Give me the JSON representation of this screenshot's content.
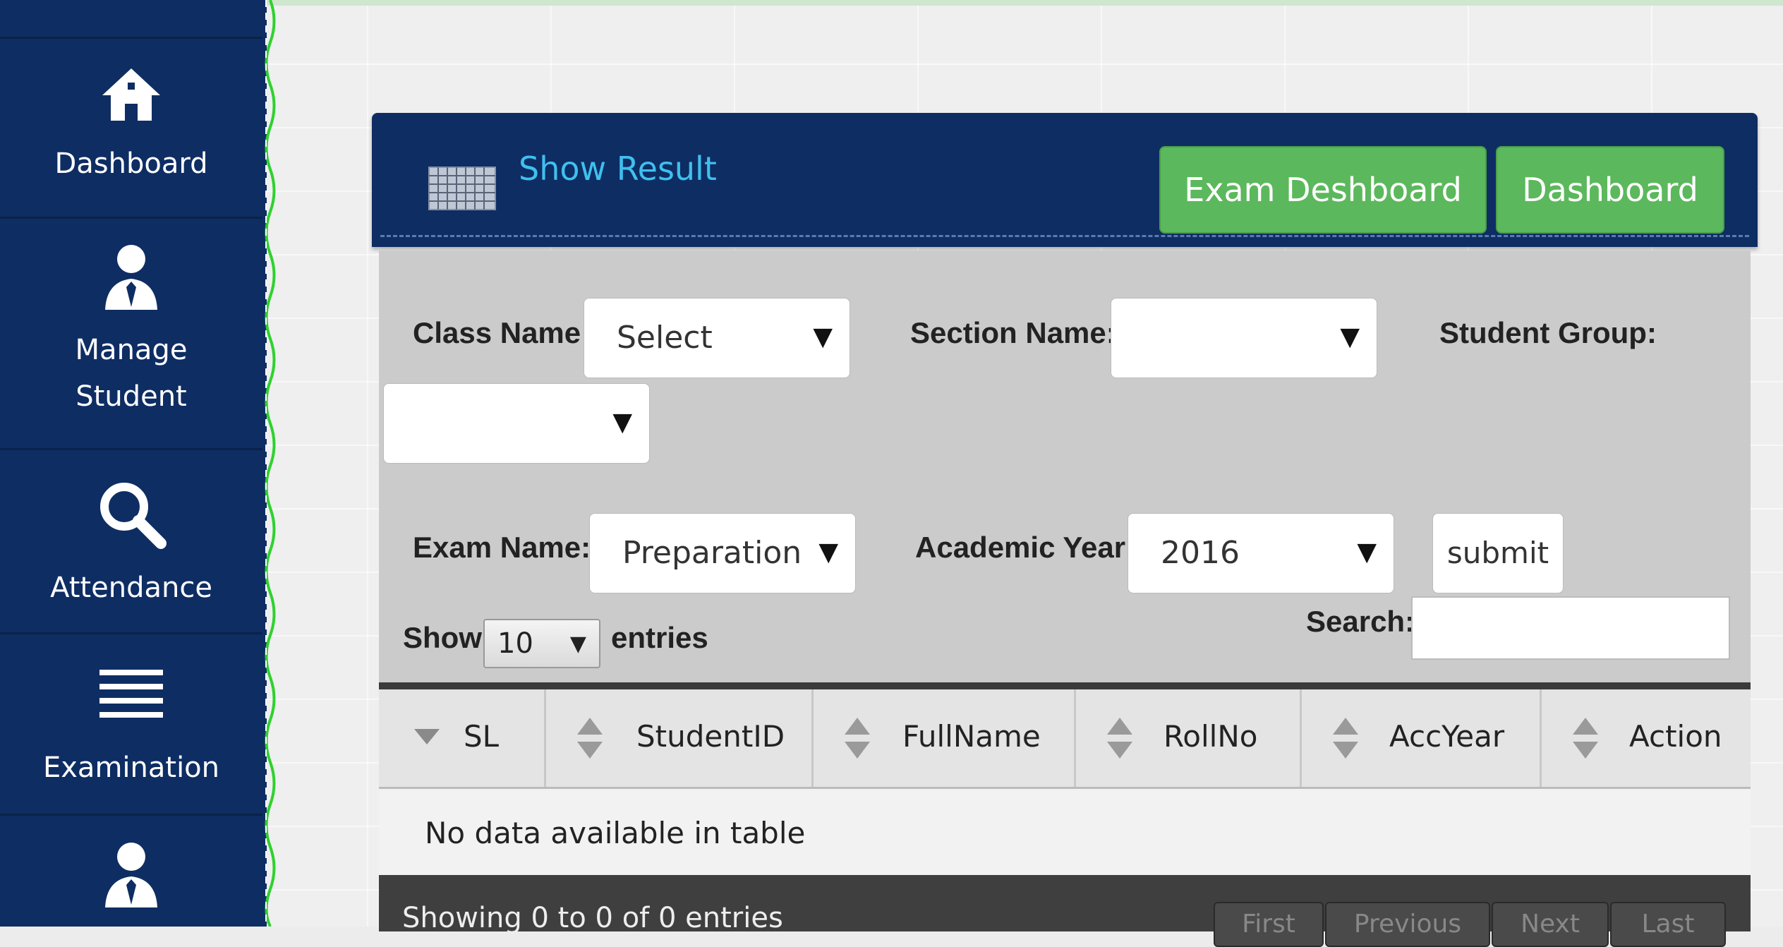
{
  "sidebar": {
    "items": [
      {
        "label_lines": [
          "Dashboard"
        ],
        "icon": "home-icon"
      },
      {
        "label_lines": [
          "Manage",
          "Student"
        ],
        "icon": "person-icon"
      },
      {
        "label_lines": [
          "Attendance"
        ],
        "icon": "search-icon"
      },
      {
        "label_lines": [
          "Examination"
        ],
        "icon": "list-icon"
      },
      {
        "label_lines": [],
        "icon": "person-icon"
      }
    ]
  },
  "header": {
    "title": "Show Result",
    "buttons": [
      "Exam Deshboard",
      "Dashboard"
    ]
  },
  "filters": {
    "class_label": "Class Name:",
    "class_value": "Select",
    "section_label": "Section Name:",
    "section_value": "",
    "group_label": "Student Group:",
    "group_value": "",
    "exam_label": "Exam Name:",
    "exam_value": "Preparation",
    "year_label": "Academic Year:",
    "year_value": "2016",
    "submit_label": "submit"
  },
  "datatable": {
    "show_label": "Show",
    "entries_value": "10",
    "entries_label": "entries",
    "search_label": "Search:",
    "search_value": "",
    "columns": [
      "SL",
      "StudentID",
      "FullName",
      "RollNo",
      "AccYear",
      "Action"
    ],
    "empty_message": "No data available in table",
    "info": "Showing 0 to 0 of 0 entries",
    "pager": [
      "First",
      "Previous",
      "Next",
      "Last"
    ]
  },
  "colors": {
    "sidebar": "#0e2d63",
    "accent_green": "#5cb85c",
    "title_blue": "#3fc0ee"
  }
}
